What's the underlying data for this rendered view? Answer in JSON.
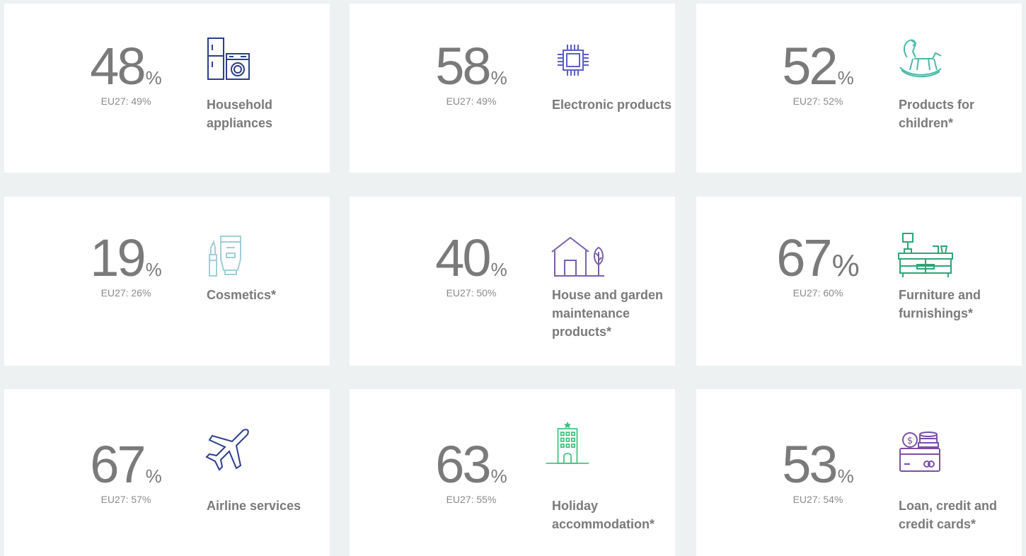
{
  "cards": [
    {
      "value": "48",
      "unit": "%",
      "eu": "EU27: 49%",
      "label": "Household appliances",
      "icon": "household-appliances-icon",
      "color": "#2c3e8c"
    },
    {
      "value": "58",
      "unit": "%",
      "eu": "EU27: 49%",
      "label": "Electronic products",
      "icon": "microchip-icon",
      "color": "#5b5fc7"
    },
    {
      "value": "52",
      "unit": "%",
      "eu": "EU27: 52%",
      "label": "Products for children*",
      "icon": "rocking-horse-icon",
      "color": "#4cb8a8"
    },
    {
      "value": "19",
      "unit": "%",
      "eu": "EU27: 26%",
      "label": "Cosmetics*",
      "icon": "cosmetics-icon",
      "color": "#9fcfd6"
    },
    {
      "value": "40",
      "unit": "%",
      "eu": "EU27: 50%",
      "label": "House and garden maintenance products*",
      "icon": "house-garden-icon",
      "color": "#7a5fa8"
    },
    {
      "value": "67",
      "unit": "%",
      "eu": "EU27: 60%",
      "label": "Furniture and furnishings*",
      "icon": "furniture-icon",
      "color": "#2aa776"
    },
    {
      "value": "67",
      "unit": "%",
      "eu": "EU27: 57%",
      "label": "Airline services",
      "icon": "airplane-icon",
      "color": "#2c3e8c"
    },
    {
      "value": "63",
      "unit": "%",
      "eu": "EU27: 55%",
      "label": "Holiday accommodation*",
      "icon": "hotel-icon",
      "color": "#3cbf7a"
    },
    {
      "value": "53",
      "unit": "%",
      "eu": "EU27: 54%",
      "label": "Loan, credit and credit cards*",
      "icon": "credit-card-coins-icon",
      "color": "#7a4fa8"
    }
  ]
}
